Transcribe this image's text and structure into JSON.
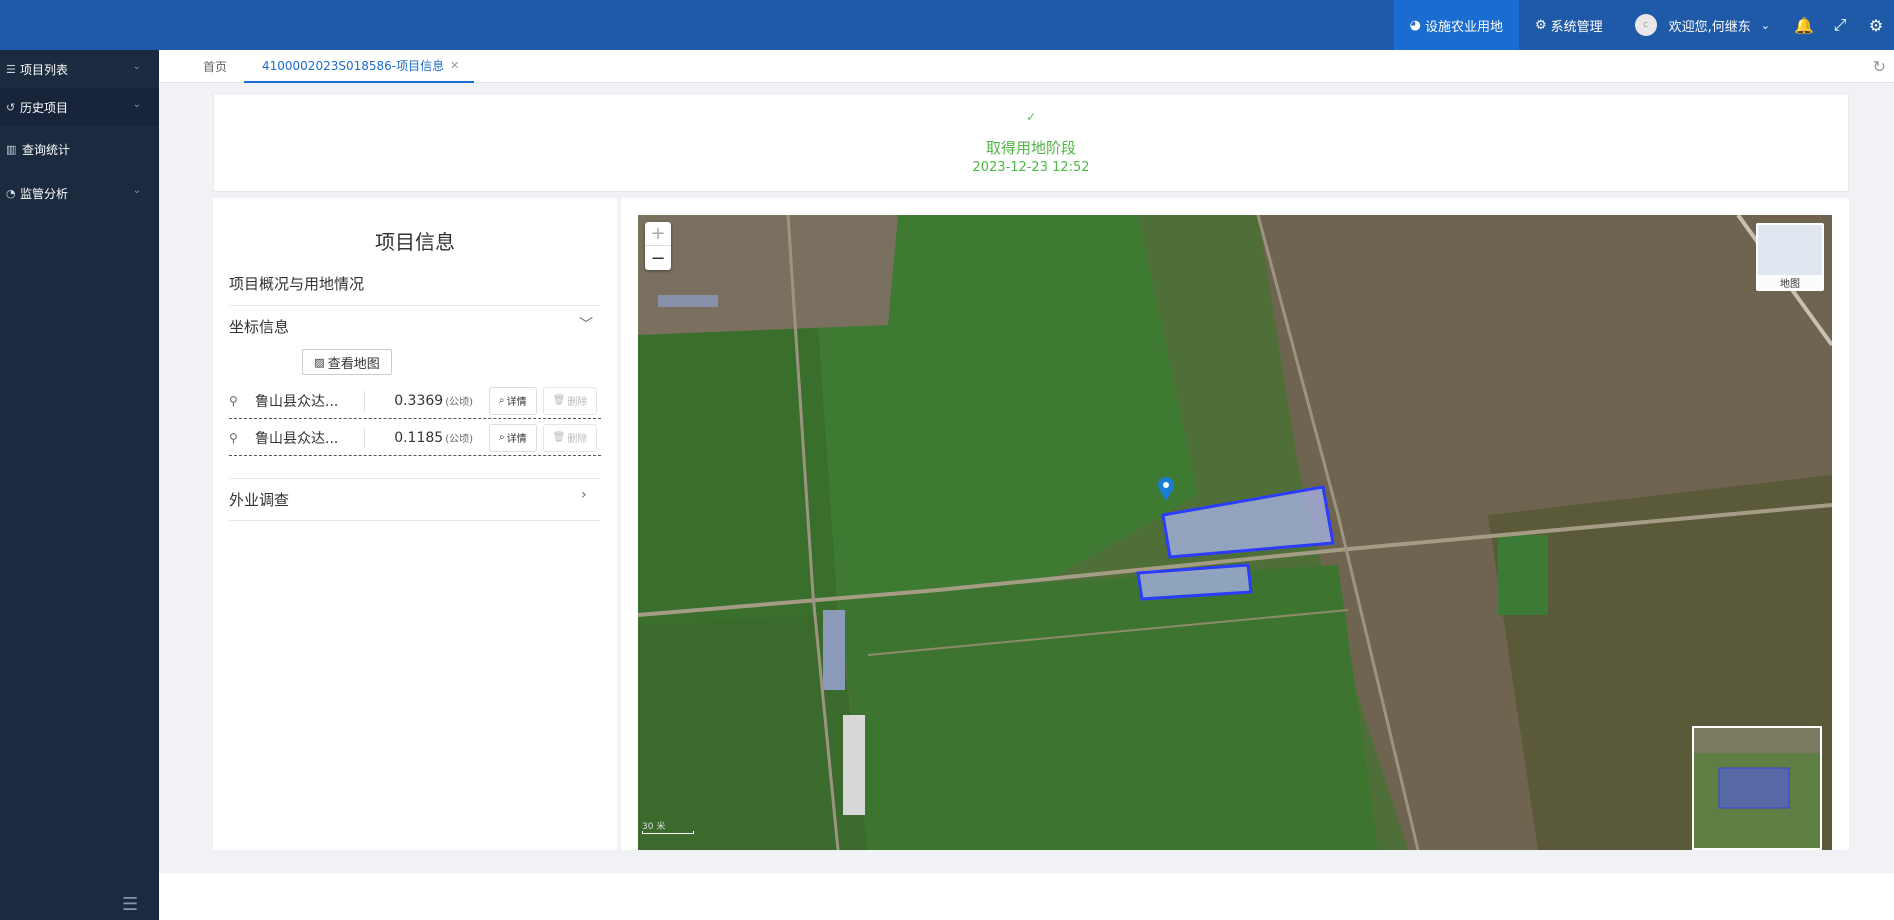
{
  "header": {
    "nav_active": "设施农业用地",
    "nav_system": "系统管理",
    "avatar_text": "c",
    "welcome": "欢迎您,何继东",
    "icons": [
      "bell-icon",
      "fullscreen-icon",
      "settings-icon"
    ]
  },
  "sidebar": {
    "items": [
      {
        "label": "项目列表",
        "icon": "list-icon",
        "has_chevron": true
      },
      {
        "label": "历史项目",
        "icon": "history-icon",
        "has_chevron": true
      },
      {
        "label": "查询统计",
        "icon": "chart-icon",
        "has_chevron": false
      },
      {
        "label": "监管分析",
        "icon": "pie-icon",
        "has_chevron": true
      }
    ]
  },
  "tabs": {
    "home": "首页",
    "active": "4100002023S018586-项目信息"
  },
  "stage": {
    "name": "取得用地阶段",
    "time": "2023-12-23 12:52"
  },
  "info": {
    "title": "项目信息",
    "overview": "项目概况与用地情况",
    "coord_title": "坐标信息",
    "view_map": "查看地图",
    "rows": [
      {
        "name": "鲁山县众达...",
        "area": "0.3369",
        "unit": "(公顷)",
        "detail": "详情",
        "delete": "删除"
      },
      {
        "name": "鲁山县众达...",
        "area": "0.1185",
        "unit": "(公顷)",
        "detail": "详情",
        "delete": "删除"
      }
    ],
    "field_survey": "外业调查"
  },
  "map": {
    "zoom_in": "+",
    "zoom_out": "−",
    "layer_label": "地图",
    "scale_label": "30 米"
  },
  "colors": {
    "header_bg": "#1f5aa8",
    "header_active": "#1b6cd0",
    "sidebar_bg": "#1c2a3f",
    "stage_green": "#52b548",
    "parcel_stroke": "#2b3cff"
  }
}
